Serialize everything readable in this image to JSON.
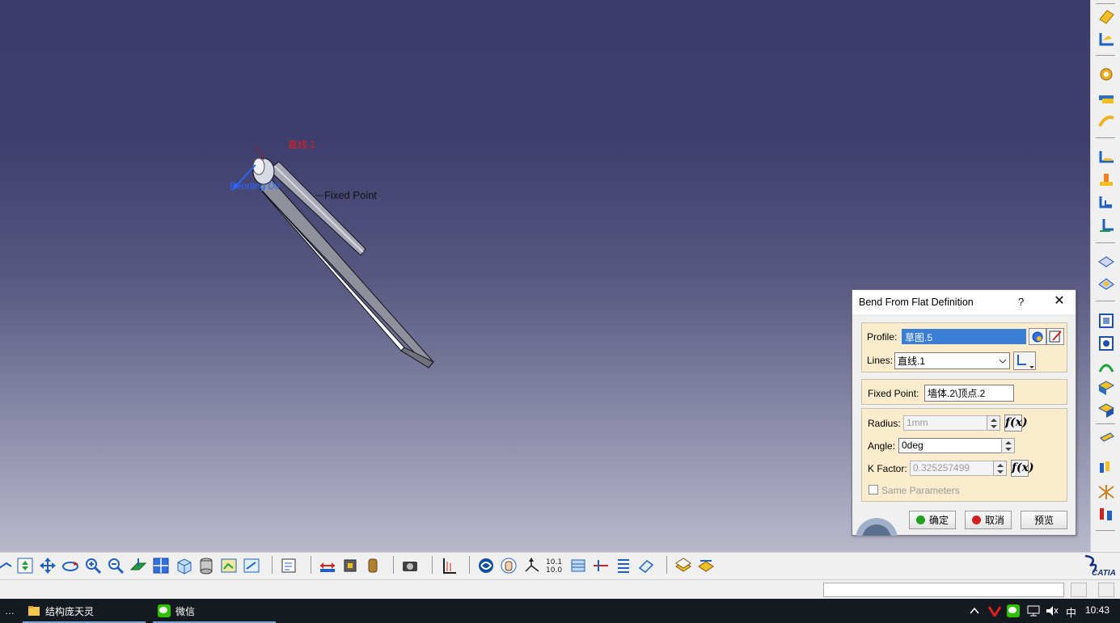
{
  "viewport": {
    "label_line": "直线.1",
    "label_direction": "Bending Dir",
    "label_fixed_point": "Fixed Point"
  },
  "dialog": {
    "title": "Bend From Flat Definition",
    "help": "?",
    "profile": {
      "label": "Profile:",
      "value": "草图.5"
    },
    "lines": {
      "label": "Lines:",
      "value": "直线.1"
    },
    "fixed_point": {
      "label": "Fixed Point:",
      "value": "墙体.2\\顶点.2"
    },
    "radius": {
      "label": "Radius:",
      "value": "1mm",
      "enabled": false
    },
    "angle": {
      "label": "Angle:",
      "value": "0deg",
      "enabled": true
    },
    "k_factor": {
      "label": "K Factor:",
      "value": "0.325257499",
      "enabled": false
    },
    "same_parameters": {
      "label": "Same Parameters",
      "checked": false,
      "enabled": false
    },
    "buttons": {
      "ok": "确定",
      "cancel": "取消",
      "preview": "预览"
    },
    "colors": {
      "ok_dot": "#22a022",
      "cancel_dot": "#d02020",
      "selected_field": "#3a7fd5"
    }
  },
  "taskbar": {
    "items": [
      {
        "label": "结构庞天灵",
        "icon": "folder-icon"
      },
      {
        "label": "微信",
        "icon": "wechat-icon"
      }
    ],
    "ime": "中",
    "clock": "10:43"
  },
  "brand": {
    "logo_text": "CATIA"
  }
}
